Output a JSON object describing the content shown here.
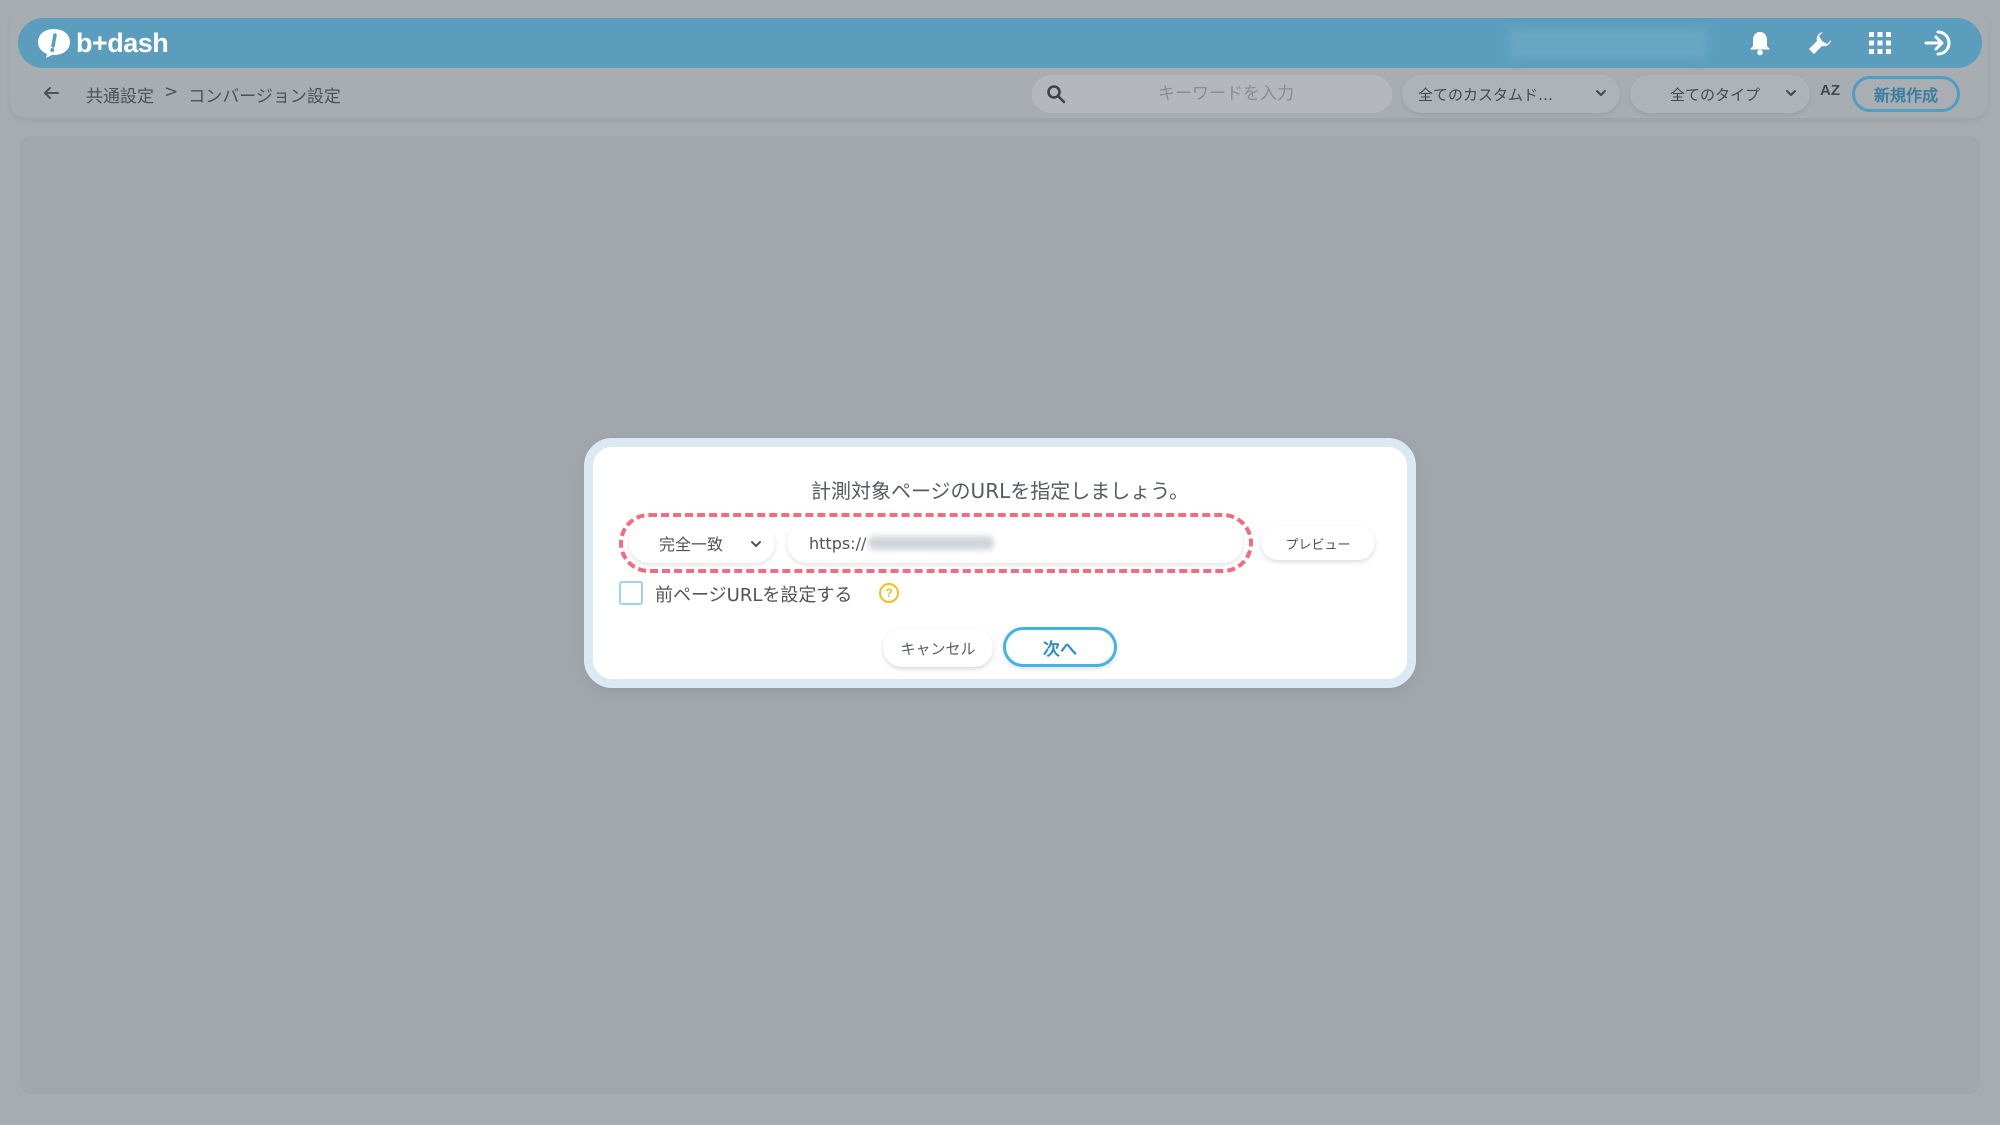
{
  "header": {
    "logo_text": "b+dash",
    "icons": [
      "bell-icon",
      "wrench-icon",
      "grid-icon",
      "sign-in-icon"
    ],
    "accent": "#5a9dbd"
  },
  "subbar": {
    "breadcrumb": [
      "共通設定",
      ">",
      "コンバージョン設定"
    ],
    "search_placeholder": "キーワードを入力",
    "filter_custom": "全てのカスタムド…",
    "filter_type": "全てのタイプ",
    "sort_label": "AZ",
    "new_button": "新規作成"
  },
  "modal": {
    "title": "計測対象ページのURLを指定しましょう。",
    "match_type": "完全一致",
    "url_prefix": "https://",
    "preview_button": "プレビュー",
    "previous_page_label": "前ページURLを設定する",
    "help_glyph": "?",
    "cancel_button": "キャンセル",
    "next_button": "次へ",
    "highlight_color": "#f06c7e"
  }
}
